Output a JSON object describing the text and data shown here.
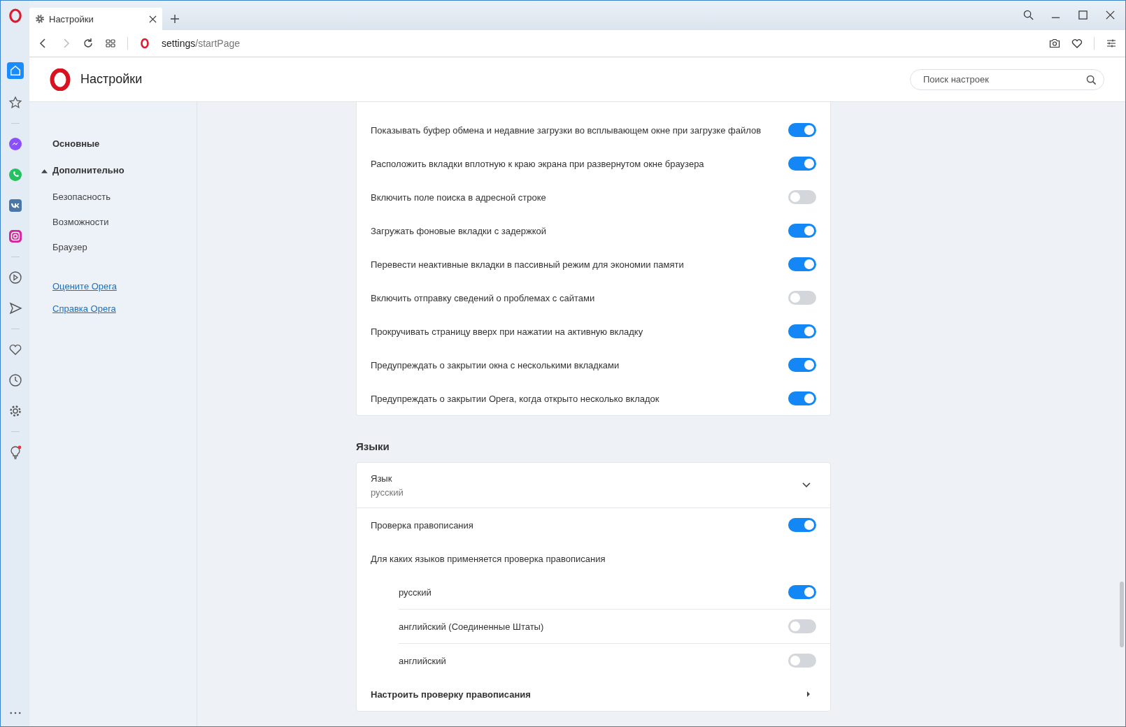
{
  "browser": {
    "tab": {
      "title": "Настройки"
    },
    "address": {
      "host": "settings",
      "path": "/startPage"
    }
  },
  "header": {
    "title": "Настройки",
    "search": {
      "placeholder": "Поиск настроек"
    }
  },
  "nav": {
    "sections": [
      {
        "label": "Основные",
        "kind": "heading"
      },
      {
        "label": "Дополнительно",
        "kind": "group",
        "expanded": true,
        "children": [
          {
            "label": "Безопасность"
          },
          {
            "label": "Возможности"
          },
          {
            "label": "Браузер"
          }
        ]
      }
    ],
    "links": [
      "Оцените Opera",
      "Справка Opera"
    ]
  },
  "settings": [
    {
      "label": "Показывать буфер обмена и недавние загрузки во всплывающем окне при загрузке файлов",
      "on": true
    },
    {
      "label": "Расположить вкладки вплотную к краю экрана при развернутом окне браузера",
      "on": true
    },
    {
      "label": "Включить поле поиска в адресной строке",
      "on": false
    },
    {
      "label": "Загружать фоновые вкладки с задержкой",
      "on": true
    },
    {
      "label": "Перевести неактивные вкладки в пассивный режим для экономии памяти",
      "on": true
    },
    {
      "label": "Включить отправку сведений о проблемах с сайтами",
      "on": false
    },
    {
      "label": "Прокручивать страницу вверх при нажатии на активную вкладку",
      "on": true
    },
    {
      "label": "Предупреждать о закрытии окна с несколькими вкладками",
      "on": true
    },
    {
      "label": "Предупреждать о закрытии Opera, когда открыто несколько вкладок",
      "on": true
    }
  ],
  "languages": {
    "title": "Языки",
    "language": {
      "label": "Язык",
      "value": "русский"
    },
    "spellcheck": {
      "label": "Проверка правописания",
      "on": true
    },
    "spell_languages_title": "Для каких языков применяется проверка правописания",
    "spell_languages": [
      {
        "label": "русский",
        "on": true
      },
      {
        "label": "английский (Соединенные Штаты)",
        "on": false
      },
      {
        "label": "английский",
        "on": false
      }
    ],
    "customize": "Настроить проверку правописания"
  }
}
